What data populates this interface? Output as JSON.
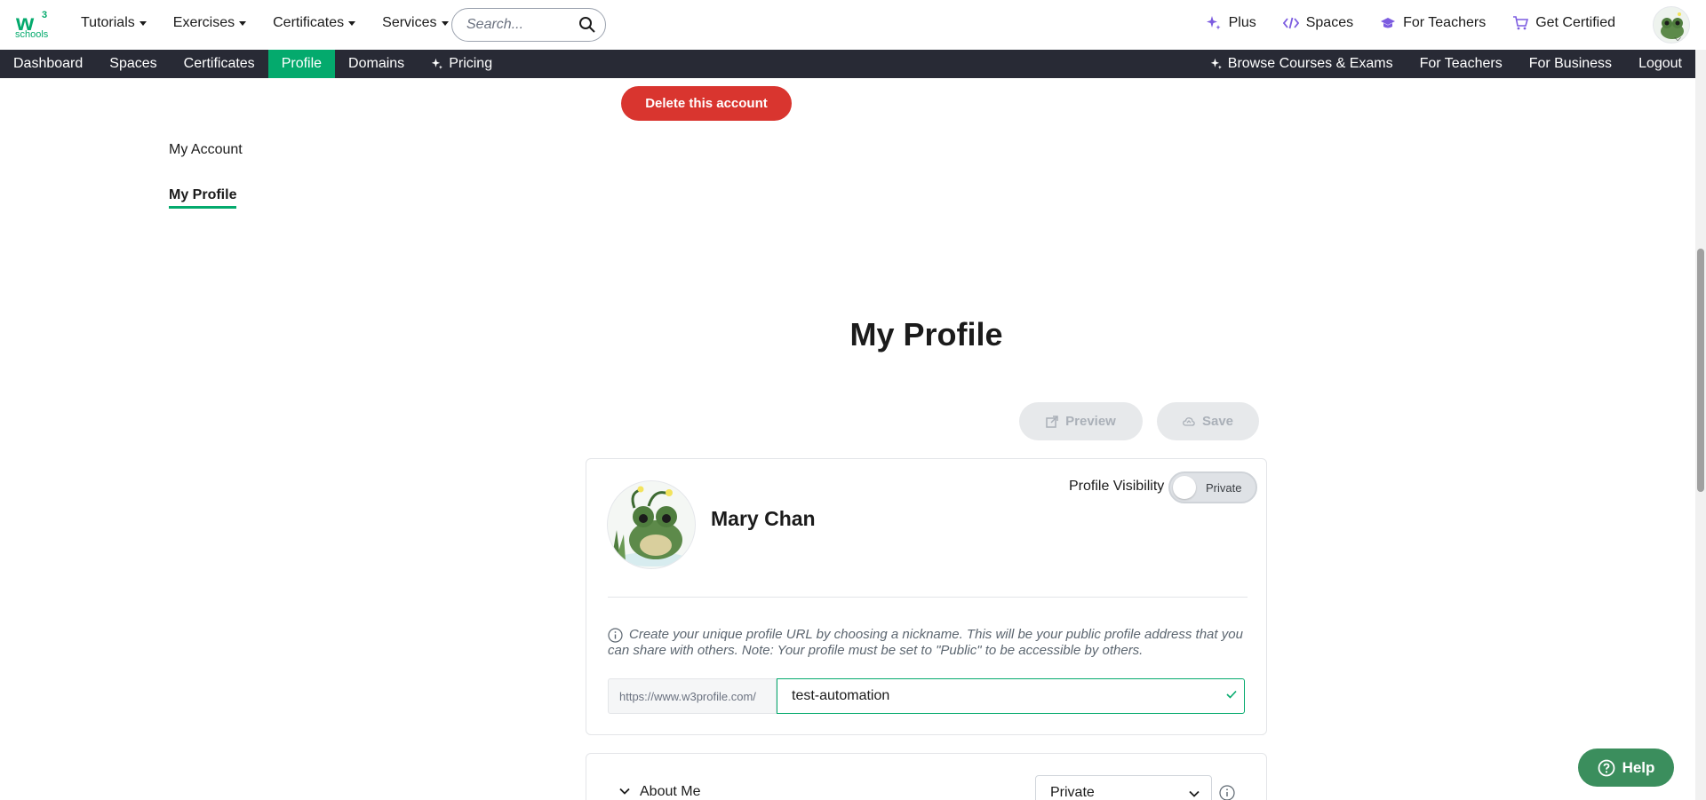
{
  "logo": {
    "superscript": "3",
    "wordmark": "schools"
  },
  "topnav": [
    {
      "label": "Tutorials"
    },
    {
      "label": "Exercises"
    },
    {
      "label": "Certificates"
    },
    {
      "label": "Services"
    }
  ],
  "search": {
    "placeholder": "Search..."
  },
  "toplinks": [
    {
      "label": "Plus",
      "icon": "sparkle-icon"
    },
    {
      "label": "Spaces",
      "icon": "code-icon"
    },
    {
      "label": "For Teachers",
      "icon": "graduation-cap-icon"
    },
    {
      "label": "Get Certified",
      "icon": "cart-icon"
    }
  ],
  "subnav": {
    "left": [
      "Dashboard",
      "Spaces",
      "Certificates",
      "Profile",
      "Domains",
      "Pricing"
    ],
    "right": [
      "Browse Courses & Exams",
      "For Teachers",
      "For Business",
      "Logout"
    ],
    "active": "Profile"
  },
  "account": {
    "delete_label": "Delete this account"
  },
  "side_menu": {
    "account": "My Account",
    "profile": "My Profile"
  },
  "page": {
    "title": "My Profile"
  },
  "actions": {
    "preview": "Preview",
    "save": "Save"
  },
  "profile": {
    "name": "Mary Chan",
    "visibility_label": "Profile Visibility",
    "visibility_value": "Private",
    "info": "Create your unique profile URL by choosing a nickname. This will be your public profile address that you can share with others. Note: Your profile must be set to \"Public\" to be accessible by others.",
    "url_prefix": "https://www.w3profile.com/",
    "url_value": "test-automation"
  },
  "about": {
    "label": "About Me",
    "visibility": "Private"
  },
  "help": {
    "label": "Help"
  },
  "colors": {
    "brand": "#04AA6D",
    "danger": "#d9352f",
    "subnav": "#282a35",
    "accent": "#7c5ce0"
  }
}
